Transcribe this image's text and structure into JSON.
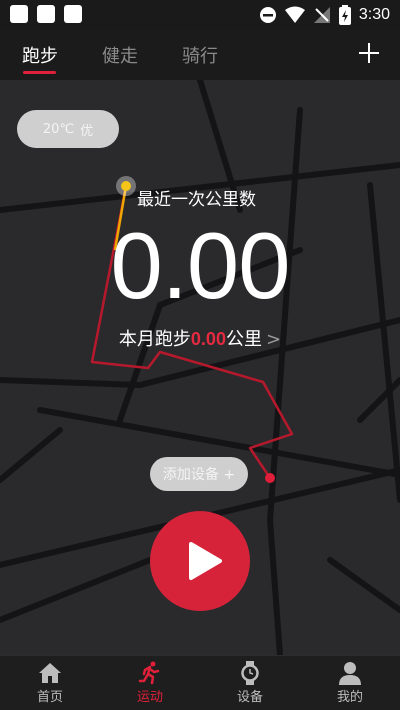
{
  "status_bar": {
    "time": "3:30"
  },
  "tabs": [
    {
      "label": "跑步",
      "active": true
    },
    {
      "label": "健走",
      "active": false
    },
    {
      "label": "骑行",
      "active": false
    }
  ],
  "weather": {
    "temperature": "20℃",
    "quality": "优"
  },
  "run": {
    "recent_label": "最近一次公里数",
    "distance": "0.00",
    "monthly_prefix": "本月跑步",
    "monthly_value": "0.00",
    "monthly_suffix": "公里",
    "monthly_chevron": ">"
  },
  "add_device": {
    "label": "添加设备 +"
  },
  "bottom_nav": [
    {
      "label": "首页",
      "icon": "home-icon"
    },
    {
      "label": "运动",
      "icon": "running-icon",
      "active": true
    },
    {
      "label": "设备",
      "icon": "watch-icon"
    },
    {
      "label": "我的",
      "icon": "profile-icon"
    }
  ],
  "colors": {
    "accent": "#e0203a",
    "background": "#2a2a2d",
    "route_start": "#f5c518"
  }
}
